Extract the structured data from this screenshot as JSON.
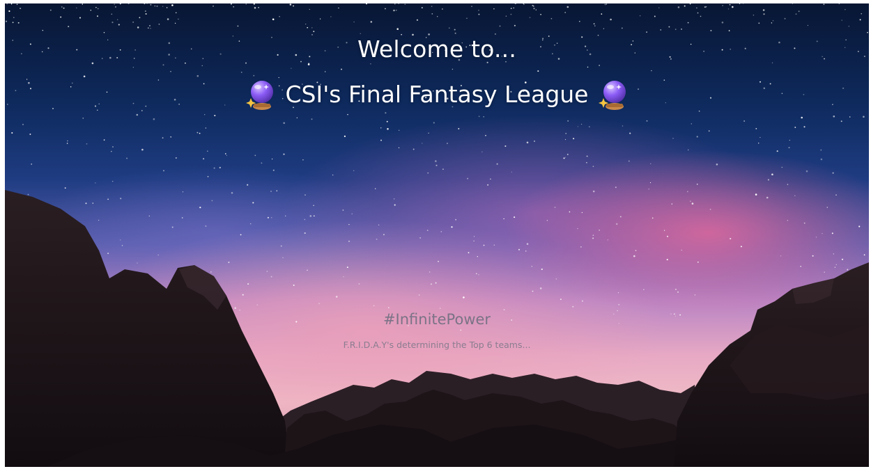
{
  "header": {
    "welcome_text": "Welcome to...",
    "league_name": "CSI's Final Fantasy League",
    "left_icon": "crystal-ball-icon",
    "right_icon": "crystal-ball-icon"
  },
  "footer": {
    "hashtag": "#InfinitePower",
    "status_text": "F.R.I.D.A.Y's determining the Top 6 teams..."
  },
  "colors": {
    "title_text": "#ffffff",
    "hashtag_text": "#7b7387",
    "status_text": "#8a7d90",
    "orb_purple": "#8b5cf6",
    "orb_base": "#c8894a",
    "sparkle": "#f6c542"
  }
}
